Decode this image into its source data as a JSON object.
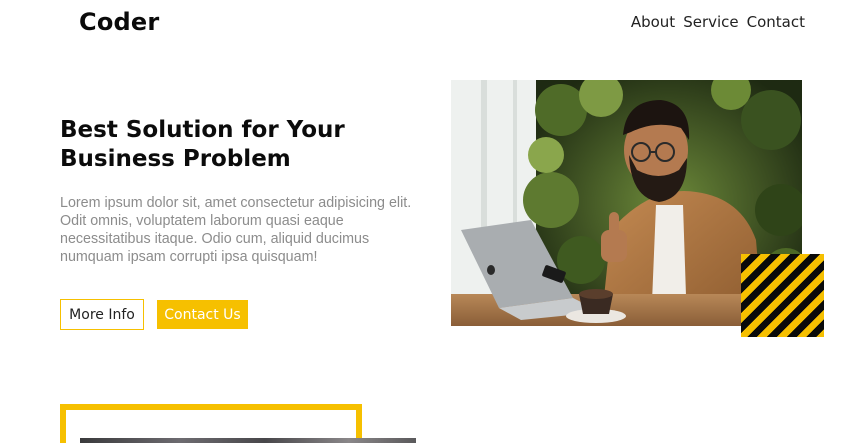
{
  "header": {
    "logo": "Coder",
    "nav": [
      "About",
      "Service",
      "Contact"
    ]
  },
  "hero": {
    "title": "Best Solution for Your Business Problem",
    "text": "Lorem ipsum dolor sit, amet consectetur adipisicing elit. Odit omnis, voluptatem laborum quasi eaque necessitatibus itaque. Odio cum, aliquid ducimus numquam ipsam corrupti ipsa quisquam!",
    "buttons": {
      "more_info": "More Info",
      "contact_us": "Contact Us"
    },
    "image_alt": "man with laptop giving thumbs up"
  },
  "colors": {
    "accent": "#f6c000",
    "heading": "#0b0b0b",
    "body_text": "#8c8c8c"
  }
}
